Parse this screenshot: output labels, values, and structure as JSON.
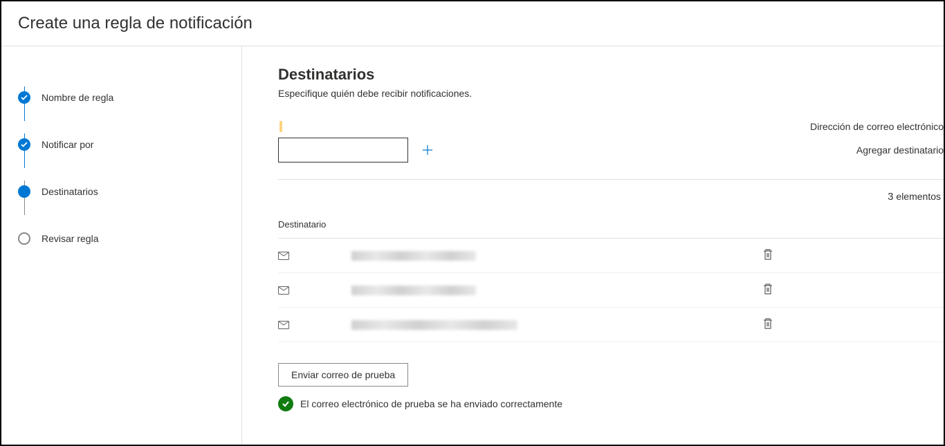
{
  "header": {
    "title": "Create una regla de notificación"
  },
  "sidebar": {
    "steps": [
      {
        "label": "Nombre de regla",
        "state": "completed"
      },
      {
        "label": "Notificar por",
        "state": "completed"
      },
      {
        "label": "Destinatarios",
        "state": "active"
      },
      {
        "label": "Revisar regla",
        "state": "pending"
      }
    ]
  },
  "main": {
    "heading": "Destinatarios",
    "subtitle": "Especifique quién debe recibir notificaciones.",
    "emailLabel": "Dirección de correo electrónico",
    "addLabel": "Agregar destinatario",
    "count": "3",
    "countLabel": "elementos",
    "tableHeader": "Destinatario",
    "testButton": "Enviar correo de prueba",
    "successMessage": "El correo electrónico de prueba se ha enviado correctamente"
  }
}
